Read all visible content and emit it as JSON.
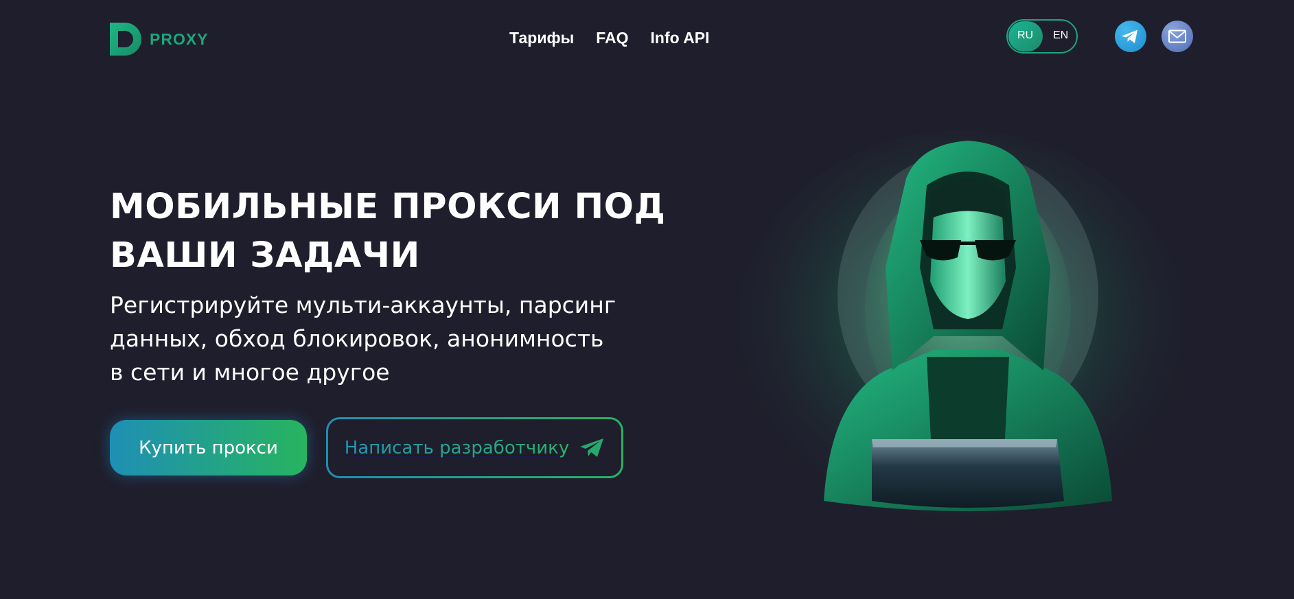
{
  "brand": {
    "name": "PROXY",
    "color": "#1fa67a"
  },
  "nav": {
    "items": [
      "Тарифы",
      "FAQ",
      "Info API"
    ]
  },
  "lang": {
    "active": "RU",
    "other": "EN"
  },
  "social": {
    "icons": [
      "telegram-icon",
      "mail-icon"
    ]
  },
  "hero": {
    "title_line1": "МОБИЛЬНЫЕ ПРОКСИ ПОД",
    "title_line2": "ВАШИ ЗАДАЧИ",
    "subtitle_line1": "Регистрируйте мульти-аккаунты, парсинг",
    "subtitle_line2": "данных, обход блокировок, анонимность",
    "subtitle_line3": "в сети и многое другое",
    "buy_label": "Купить прокси",
    "dev_label": "Написать разработчику",
    "dev_icon": "paper-plane-icon"
  },
  "colors": {
    "background": "#1f1e2c",
    "gradient_start": "#1e8fb5",
    "gradient_end": "#27b45f"
  }
}
